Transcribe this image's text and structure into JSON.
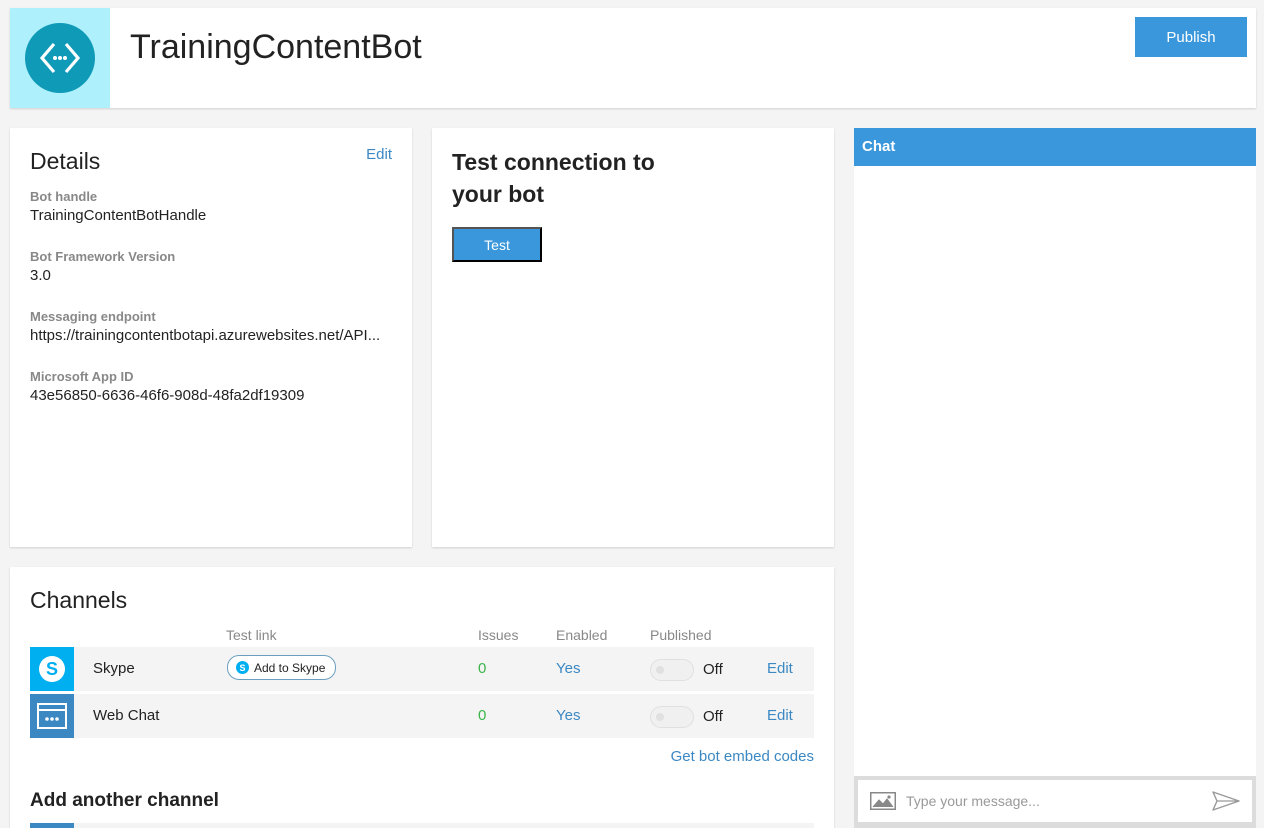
{
  "header": {
    "bot_name": "TrainingContentBot",
    "publish_label": "Publish"
  },
  "details": {
    "title": "Details",
    "edit_label": "Edit",
    "fields": [
      {
        "label": "Bot handle",
        "value": "TrainingContentBotHandle"
      },
      {
        "label": "Bot Framework Version",
        "value": "3.0"
      },
      {
        "label": "Messaging endpoint",
        "value": "https://trainingcontentbotapi.azurewebsites.net/API..."
      },
      {
        "label": "Microsoft App ID",
        "value": "43e56850-6636-46f6-908d-48fa2df19309"
      }
    ]
  },
  "test": {
    "title": "Test connection to your bot",
    "button_label": "Test"
  },
  "channels": {
    "title": "Channels",
    "columns": {
      "test_link": "Test link",
      "issues": "Issues",
      "enabled": "Enabled",
      "published": "Published"
    },
    "rows": [
      {
        "name": "Skype",
        "test_link": "Add to Skype",
        "issues": "0",
        "enabled": "Yes",
        "published": "Off",
        "edit": "Edit",
        "icon": "skype-icon"
      },
      {
        "name": "Web Chat",
        "test_link": "",
        "issues": "0",
        "enabled": "Yes",
        "published": "Off",
        "edit": "Edit",
        "icon": "web-chat-icon"
      }
    ],
    "embed_link": "Get bot embed codes",
    "add_another": "Add another channel"
  },
  "chat": {
    "title": "Chat",
    "placeholder": "Type your message..."
  },
  "colors": {
    "accent": "#3b97db",
    "logo_bg": "#aef0fb",
    "logo_circle": "#0f9ab8",
    "success": "#3bb54a"
  }
}
